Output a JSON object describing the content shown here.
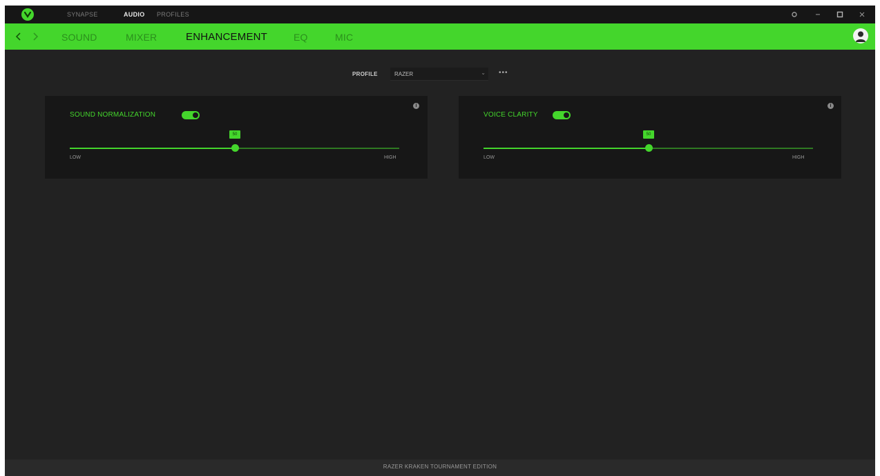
{
  "titlebar": {
    "logo_icon": "razer-logo-icon",
    "tabs": [
      {
        "label": "SYNAPSE",
        "active": false
      },
      {
        "label": "AUDIO",
        "active": true
      },
      {
        "label": "PROFILES",
        "active": false
      }
    ],
    "controls": {
      "settings": "gear-icon",
      "minimize": "minimize-icon",
      "maximize": "maximize-icon",
      "close": "close-icon"
    }
  },
  "nav": {
    "back_icon": "chevron-left-icon",
    "forward_icon": "chevron-right-icon",
    "tabs": [
      {
        "label": "SOUND",
        "active": false
      },
      {
        "label": "MIXER",
        "active": false
      },
      {
        "label": "ENHANCEMENT",
        "active": true
      },
      {
        "label": "EQ",
        "active": false
      },
      {
        "label": "MIC",
        "active": false
      }
    ],
    "avatar_icon": "user-avatar-icon"
  },
  "profile": {
    "label": "PROFILE",
    "value": "RAZER",
    "more_label": "•••"
  },
  "cards": [
    {
      "title": "SOUND NORMALIZATION",
      "enabled": true,
      "slider_value": 50,
      "slider_badge": "50",
      "low_label": "LOW",
      "high_label": "HIGH"
    },
    {
      "title": "VOICE CLARITY",
      "enabled": true,
      "slider_value": 50,
      "slider_badge": "50",
      "low_label": "LOW",
      "high_label": "HIGH"
    }
  ],
  "footer": {
    "device_name": "RAZER KRAKEN TOURNAMENT EDITION"
  },
  "colors": {
    "accent": "#44d62c",
    "background": "#222222",
    "card": "#171717",
    "titlebar": "#161616"
  }
}
